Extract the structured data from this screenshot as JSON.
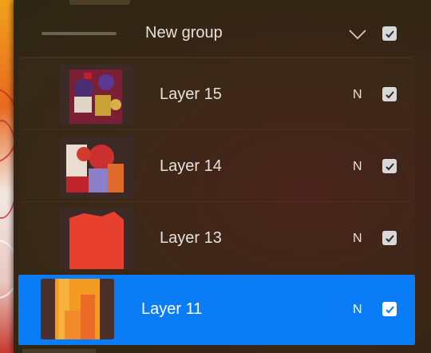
{
  "group": {
    "label": "New group",
    "icon": "chevron-down-icon",
    "visible": true
  },
  "layers": [
    {
      "label": "Layer 15",
      "blend_mode": "N",
      "visible": true,
      "selected": false
    },
    {
      "label": "Layer 14",
      "blend_mode": "N",
      "visible": true,
      "selected": false
    },
    {
      "label": "Layer 13",
      "blend_mode": "N",
      "visible": true,
      "selected": false
    },
    {
      "label": "Layer 11",
      "blend_mode": "N",
      "visible": true,
      "selected": true
    }
  ],
  "colors": {
    "selected_row": "#0a7cf6",
    "panel_bg": "#2d2614",
    "text": "#e6e2dc",
    "checkbox": "#d8d8d8"
  }
}
